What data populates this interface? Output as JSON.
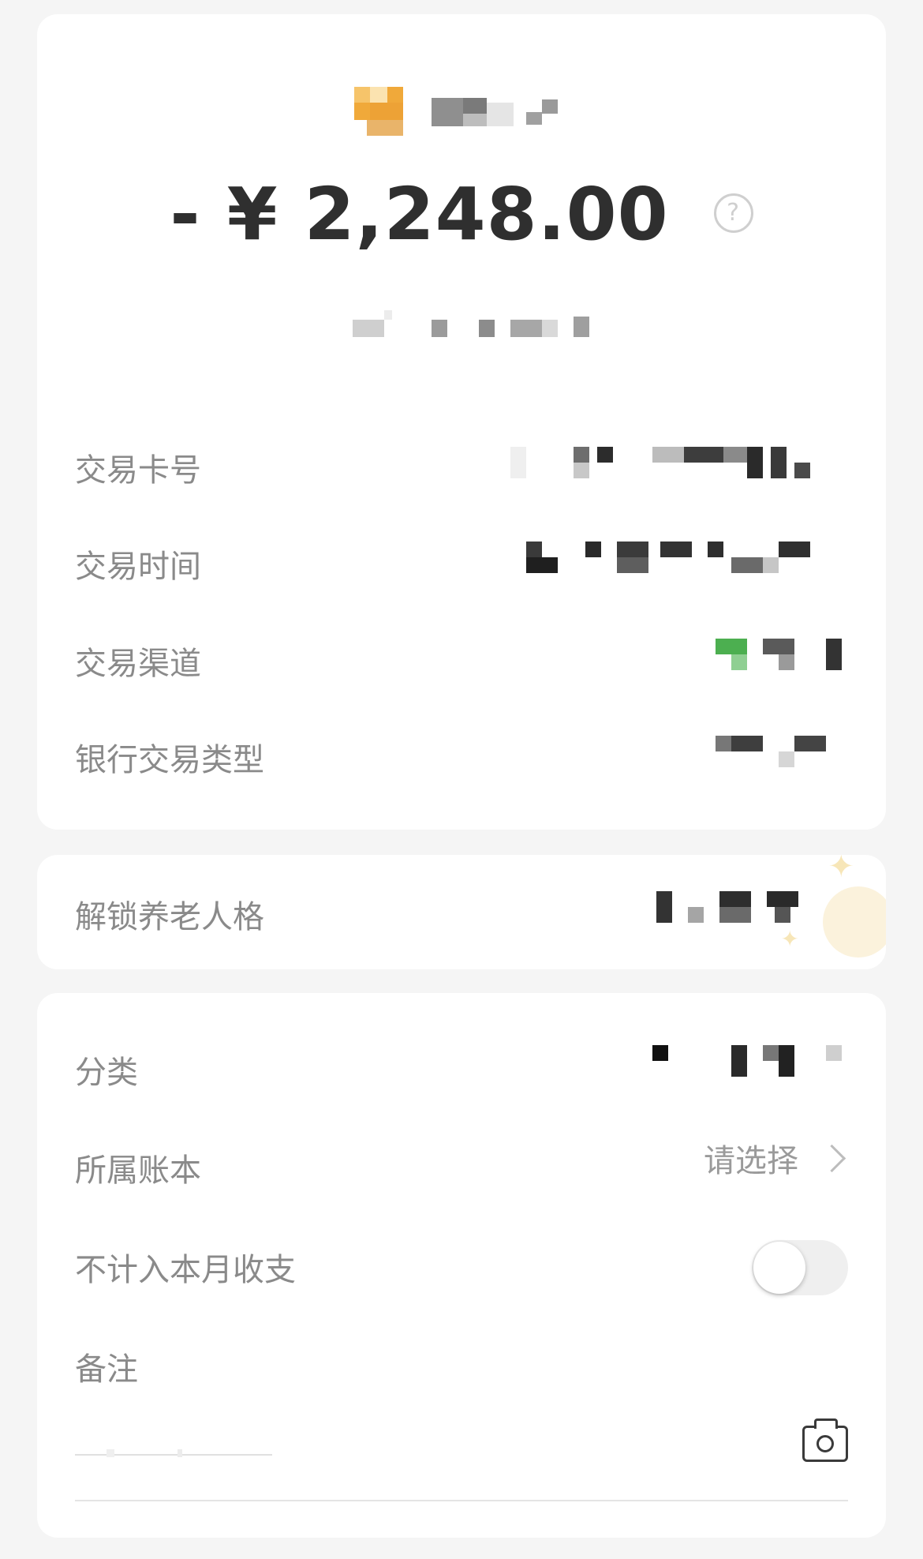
{
  "transaction": {
    "amount": "- ¥ 2,248.00",
    "help_icon": "question-circle-icon",
    "merchant_name": "",
    "subtitle": ""
  },
  "details": {
    "rows": [
      {
        "label": "交易卡号",
        "value": ""
      },
      {
        "label": "交易时间",
        "value": ""
      },
      {
        "label": "交易渠道",
        "value": ""
      },
      {
        "label": "银行交易类型",
        "value": ""
      }
    ]
  },
  "promo": {
    "label": "解锁养老人格",
    "value": "",
    "icon": "coin-sparkle-icon"
  },
  "settings": {
    "category_label": "分类",
    "category_value": "",
    "ledger_label": "所属账本",
    "ledger_value": "请选择",
    "exclude_label": "不计入本月收支",
    "exclude_toggle": false,
    "note_label": "备注",
    "note_placeholder": "",
    "camera_icon": "camera-icon"
  },
  "colors": {
    "background": "#f5f5f5",
    "card": "#ffffff",
    "amount_text": "#2f2f2f",
    "label_text": "#8a8a8a",
    "logo_orange": "#f0a93a",
    "channel_green": "#4caf50"
  }
}
